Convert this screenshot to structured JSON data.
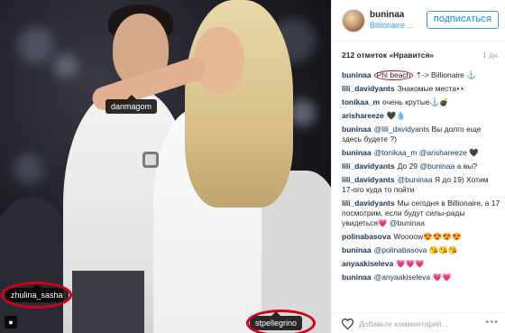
{
  "photo": {
    "tags": {
      "danmagom": "danmagom",
      "zhulina": "zhulina_sasha",
      "stpellegrino": "stpellegrino"
    }
  },
  "header": {
    "username": "buninaa",
    "location": "Billionaire ...",
    "follow_label": "ПОДПИСАТЬСЯ"
  },
  "stats": {
    "likes": "212 отметок «Нравится»",
    "age": "1 дн."
  },
  "comments": [
    {
      "user": "buninaa",
      "parts": [
        "",
        "Phi beach",
        " ⇡-> Billionaire ⚓"
      ]
    },
    {
      "user": "lili_davidyants",
      "text": "Знакомые места👀"
    },
    {
      "user": "tonikaa_m",
      "text": "очень крутые⚓💣"
    },
    {
      "user": "arishareeze",
      "text": "🖤💧"
    },
    {
      "user": "buninaa",
      "mention": "@lili_davidyants",
      "text": " Вы долго еще здесь будете ?)"
    },
    {
      "user": "buninaa",
      "mention": "@tonikaa_m @arishareeze",
      "text": " 🖤"
    },
    {
      "user": "lili_davidyants",
      "mention": "@buninaa",
      "text": " а вы?",
      "prefix": "До 29 "
    },
    {
      "user": "lili_davidyants",
      "mention": "",
      "text": "Я до 19) Хотим 17-ого куда то пойти"
    },
    {
      "user": "lili_davidyants",
      "mention": "@buninaa",
      "text": "",
      "prefix": "Мы сегодня в Billionaire, а 17 посмотрим, если будут силы-рады увидеться💗 "
    },
    {
      "user": "polinabasova",
      "text": "Woooow😍😍😍😍"
    },
    {
      "user": "buninaa",
      "mention": "@polinabasova",
      "text": " 😘😘😘"
    },
    {
      "user": "anyaakiseleva",
      "text": "💗💗💗"
    },
    {
      "user": "buninaa",
      "mention": "@anyaakiseleva",
      "text": " 💗💗"
    }
  ],
  "footer": {
    "placeholder": "Добавьте комментарий...",
    "more": "•••"
  }
}
